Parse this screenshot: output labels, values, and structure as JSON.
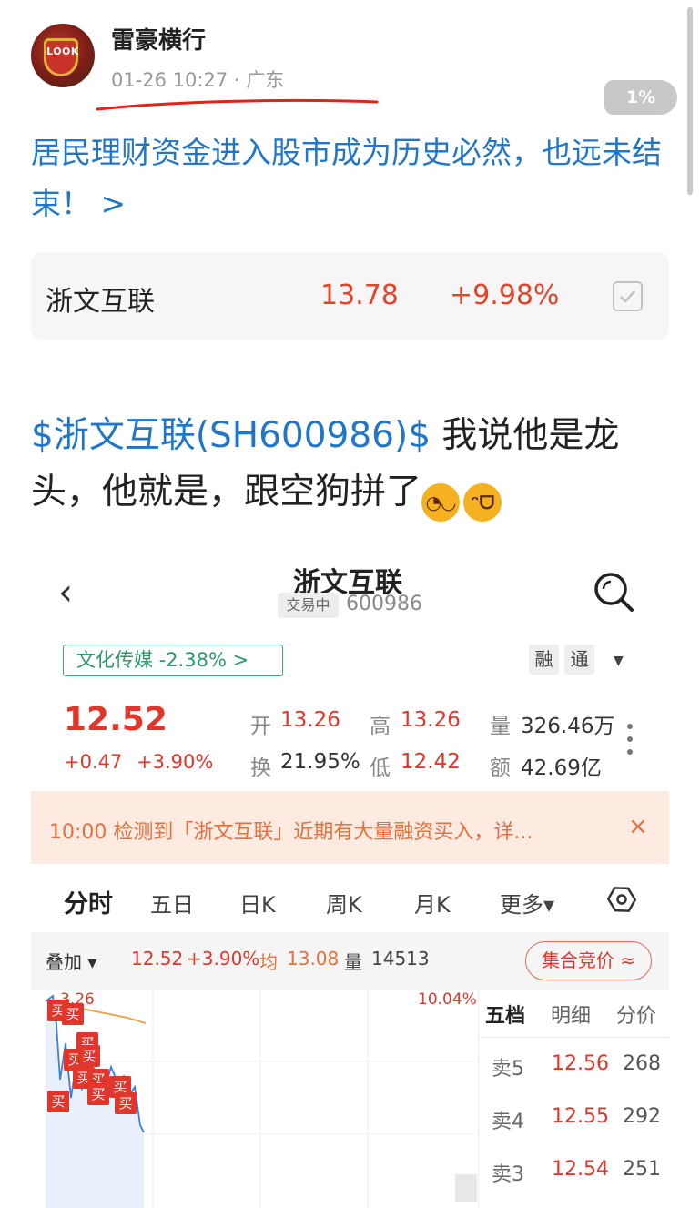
{
  "post": {
    "username": "雷豪横行",
    "avatar_text": "LOOK",
    "meta": "01-26 10:27 · 广东",
    "scroll_percent": "1%",
    "headline": "居民理财资金进入股市成为历史必然，也远未结束！ >",
    "stock_card": {
      "name": "浙文互联",
      "price": "13.78",
      "change": "+9.98%"
    },
    "body_tag": "$浙文互联(SH600986)$",
    "body_text": " 我说他是龙头，他就是，跟空狗拼了",
    "emojis": [
      "smirk-face-emoji",
      "grin-face-emoji"
    ]
  },
  "app": {
    "title": "浙文互联",
    "status_badge": "交易中",
    "code": "600986",
    "sector": "文化传媒 -2.38% >",
    "margin_tags": [
      "融",
      "通"
    ],
    "price": "12.52",
    "change_abs": "+0.47",
    "change_pct": "+3.90%",
    "quote": {
      "open_label": "开",
      "open": "13.26",
      "high_label": "高",
      "high": "13.26",
      "vol_label": "量",
      "vol": "326.46万",
      "turnover_label": "换",
      "turnover": "21.95%",
      "low_label": "低",
      "low": "12.42",
      "amount_label": "额",
      "amount": "42.69亿"
    },
    "alert": "10:00 检测到「浙文互联」近期有大量融资买入，详...",
    "alert_close": "×",
    "tabs": [
      "分时",
      "五日",
      "日K",
      "周K",
      "月K",
      "更多▾"
    ],
    "subbar": {
      "overlay": "叠加 ▾",
      "price": "12.52",
      "pct": "+3.90%",
      "avg_label": "均",
      "avg": "13.08",
      "vol_label": "量",
      "vol": "14513",
      "auction": "集合竞价"
    },
    "chart": {
      "top_pct_label": "10.04%",
      "price_label": "3.26",
      "buy_label": "买"
    },
    "orderbook": {
      "tabs": [
        "五档",
        "明细",
        "分价"
      ],
      "rows": [
        {
          "label": "卖5",
          "price": "12.56",
          "vol": "268"
        },
        {
          "label": "卖4",
          "price": "12.55",
          "vol": "292"
        },
        {
          "label": "卖3",
          "price": "12.54",
          "vol": "251"
        }
      ]
    }
  },
  "colors": {
    "link_blue": "#2276c9",
    "up_red": "#e0362c",
    "sector_green": "#2b9a67",
    "alert_orange": "#e5703d"
  }
}
